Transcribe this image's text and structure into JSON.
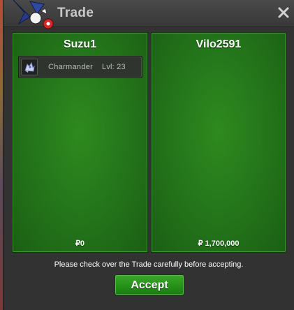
{
  "window": {
    "title": "Trade",
    "close_icon": "close-icon",
    "logo_icon": "pokeball-logo-icon"
  },
  "trade": {
    "left": {
      "player_name": "Suzu1",
      "money": "₽0",
      "items": [
        {
          "icon": "charmander-sprite-icon",
          "name": "Charmander",
          "level": "Lvl: 23"
        }
      ]
    },
    "right": {
      "player_name": "Vilo2591",
      "money": "₽ 1,700,000",
      "items": []
    }
  },
  "footer": {
    "notice": "Please check over the Trade carefully before accepting.",
    "accept_label": "Accept"
  },
  "colors": {
    "panel_green": "#23731a",
    "button_green": "#259019",
    "window_bg": "#323232"
  }
}
